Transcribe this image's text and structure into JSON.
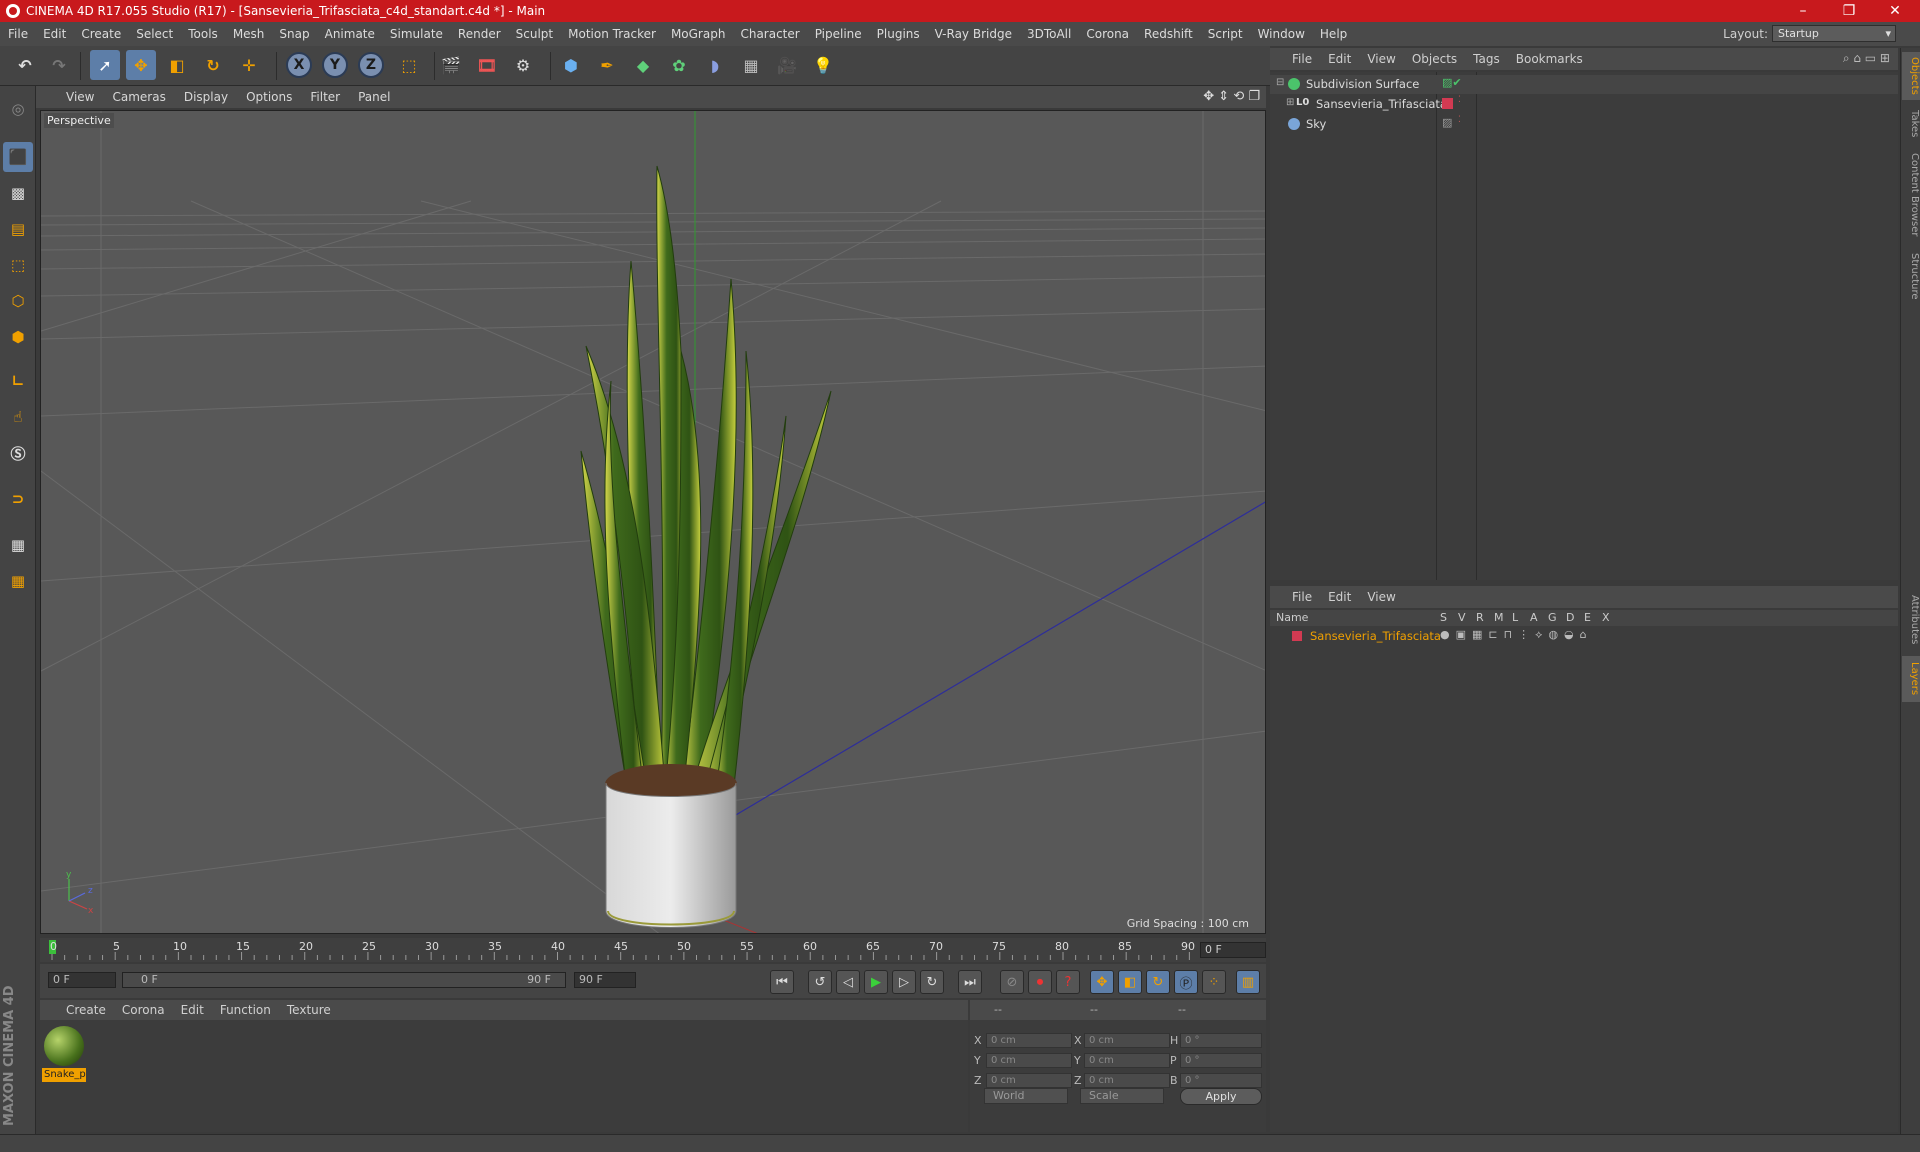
{
  "title_bar": {
    "title": "CINEMA 4D R17.055 Studio (R17) - [Sansevieria_Trifasciata_c4d_standart.c4d *] - Main"
  },
  "window_controls": {
    "minimize": "–",
    "maximize": "❐",
    "close": "✕"
  },
  "menu": [
    "File",
    "Edit",
    "Create",
    "Select",
    "Tools",
    "Mesh",
    "Snap",
    "Animate",
    "Simulate",
    "Render",
    "Sculpt",
    "Motion Tracker",
    "MoGraph",
    "Character",
    "Pipeline",
    "Plugins",
    "V-Ray Bridge",
    "3DToAll",
    "Corona",
    "Redshift",
    "Script",
    "Window",
    "Help"
  ],
  "layout": {
    "label": "Layout:",
    "value": "Startup"
  },
  "viewport": {
    "menu": [
      "View",
      "Cameras",
      "Display",
      "Options",
      "Filter",
      "Panel"
    ],
    "label": "Perspective",
    "grid_spacing": "Grid Spacing : 100 cm"
  },
  "timeline": {
    "ticks": [
      "0",
      "5",
      "10",
      "15",
      "20",
      "25",
      "30",
      "35",
      "40",
      "45",
      "50",
      "55",
      "60",
      "65",
      "70",
      "75",
      "80",
      "85",
      "90"
    ],
    "current_frame": "0 F",
    "start_field": "0 F",
    "range_start": "0 F",
    "range_end": "90 F",
    "end_field": "90 F"
  },
  "material_manager": {
    "menu": [
      "Create",
      "Corona",
      "Edit",
      "Function",
      "Texture"
    ],
    "material_name": "Snake_p"
  },
  "coordinates": {
    "header": [
      "--",
      "--",
      "--"
    ],
    "rows": [
      {
        "l1": "X",
        "v1": "0 cm",
        "l2": "X",
        "v2": "0 cm",
        "l3": "H",
        "v3": "0 °"
      },
      {
        "l1": "Y",
        "v1": "0 cm",
        "l2": "Y",
        "v2": "0 cm",
        "l3": "P",
        "v3": "0 °"
      },
      {
        "l1": "Z",
        "v1": "0 cm",
        "l2": "Z",
        "v2": "0 cm",
        "l3": "B",
        "v3": "0 °"
      }
    ],
    "space": "World",
    "mode": "Scale",
    "apply": "Apply"
  },
  "object_manager": {
    "menu": [
      "File",
      "Edit",
      "View",
      "Objects",
      "Tags",
      "Bookmarks"
    ],
    "objects": [
      "Subdivision Surface",
      "Sansevieria_Trifasciata",
      "Sky"
    ],
    "lo_badge": "L0"
  },
  "layer_manager": {
    "menu": [
      "File",
      "Edit",
      "View"
    ],
    "columns": [
      "Name",
      "S",
      "V",
      "R",
      "M",
      "L",
      "A",
      "G",
      "D",
      "E",
      "X"
    ],
    "layer_name": "Sansevieria_Trifasciata"
  },
  "side_tabs": [
    "Objects",
    "Takes",
    "Content Browser",
    "Structure",
    "Attributes",
    "Layers"
  ],
  "brand": "MAXON CINEMA 4D",
  "colors": {
    "accent_orange": "#f0a000",
    "title_red": "#c8191d",
    "layer_red": "#d23a52",
    "selection_blue": "#5d7ea8"
  }
}
